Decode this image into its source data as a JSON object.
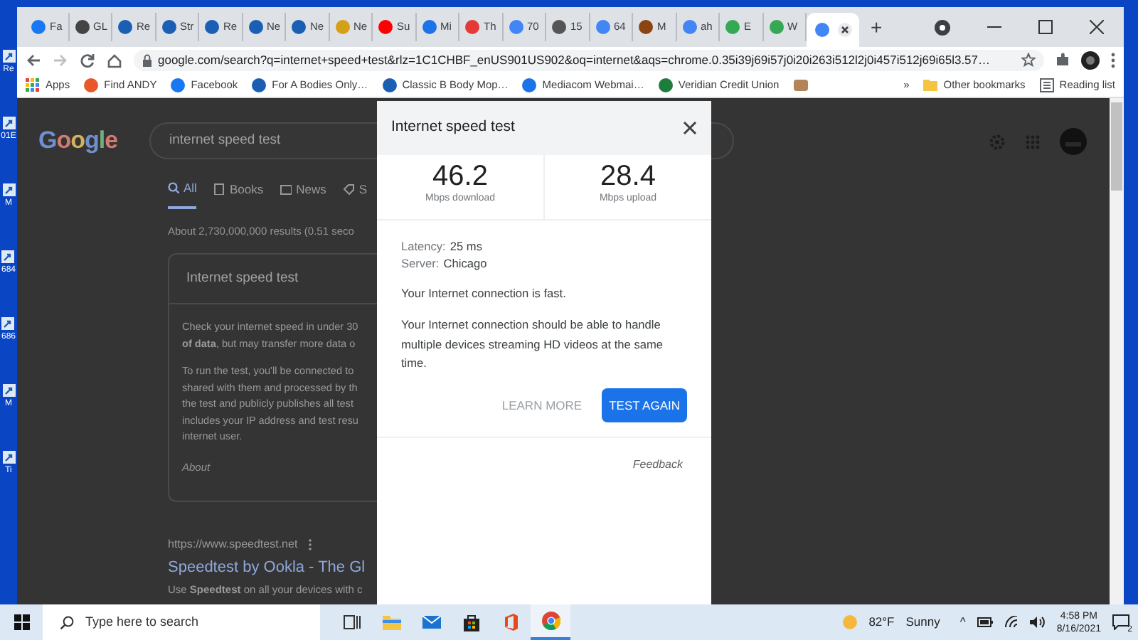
{
  "desktop_icons": [
    {
      "label": "Re"
    },
    {
      "label": "01E"
    },
    {
      "label": "M"
    },
    {
      "label": "684"
    },
    {
      "label": "686"
    },
    {
      "label": "M"
    },
    {
      "label": "Ti"
    }
  ],
  "browser": {
    "tabs": [
      {
        "label": "Fa",
        "color": "#1877f2",
        "selected": false
      },
      {
        "label": "GL",
        "color": "#444444",
        "selected": false
      },
      {
        "label": "Re",
        "color": "#1a5fb4",
        "selected": false
      },
      {
        "label": "Str",
        "color": "#1a5fb4",
        "selected": false
      },
      {
        "label": "Re",
        "color": "#1a5fb4",
        "selected": false
      },
      {
        "label": "Ne",
        "color": "#1a5fb4",
        "selected": false
      },
      {
        "label": "Ne",
        "color": "#1a5fb4",
        "selected": false
      },
      {
        "label": "Ne",
        "color": "#d4a017",
        "selected": false
      },
      {
        "label": "Su",
        "color": "#ff0000",
        "selected": false
      },
      {
        "label": "Mi",
        "color": "#1a73e8",
        "selected": false
      },
      {
        "label": "Th",
        "color": "#e53935",
        "selected": false
      },
      {
        "label": "70",
        "color": "#4285f4",
        "selected": false
      },
      {
        "label": "15",
        "color": "#555555",
        "selected": false
      },
      {
        "label": "64",
        "color": "#4285f4",
        "selected": false
      },
      {
        "label": "M",
        "color": "#8b4513",
        "selected": false
      },
      {
        "label": "ah",
        "color": "#4285f4",
        "selected": false
      },
      {
        "label": "E",
        "color": "#34a853",
        "selected": false
      },
      {
        "label": "W",
        "color": "#34a853",
        "selected": false
      },
      {
        "color": "#4285f4",
        "selected": true
      }
    ],
    "new_tab": "+",
    "address": "google.com/search?q=internet+speed+test&rlz=1C1CHBF_enUS901US902&oq=internet&aqs=chrome.0.35i39j69i57j0i20i263i512l2j0i457i512j69i65l3.57…",
    "bookmarks": [
      {
        "kind": "apps",
        "label": "Apps"
      },
      {
        "kind": "link",
        "label": "Find ANDY",
        "color": "#e8562a"
      },
      {
        "kind": "link",
        "label": "Facebook",
        "color": "#1877f2"
      },
      {
        "kind": "link",
        "label": "For A Bodies Only…",
        "color": "#1a5fb4"
      },
      {
        "kind": "link",
        "label": "Classic B Body Mop…",
        "color": "#1a5fb4"
      },
      {
        "kind": "link",
        "label": "Mediacom Webmai…",
        "color": "#1a73e8"
      },
      {
        "kind": "link",
        "label": "Veridian Credit Union",
        "color": "#1e7d3a"
      },
      {
        "kind": "icon",
        "color": "#b5835a"
      }
    ],
    "overflow": "»",
    "other_bookmarks": "Other bookmarks",
    "reading_list": "Reading list"
  },
  "google": {
    "logo": "Google",
    "search": "internet speed test",
    "tabs": [
      {
        "label": "All",
        "selected": true
      },
      {
        "label": "Books",
        "selected": false
      },
      {
        "label": "News",
        "selected": false
      },
      {
        "label": "S",
        "selected": false
      }
    ],
    "result_stats": "About 2,730,000,000 results (0.51 seco",
    "card_title": "Internet speed test",
    "card_para_1": [
      "Check your internet speed in under 30",
      "**of data**, but may transfer more data o"
    ],
    "card_para_2": [
      "To run the test, you'll be connected to",
      "shared with them and processed by th",
      "the test and publicly publishes all test",
      "includes your IP address and test resu",
      "internet user."
    ],
    "card_about": "About",
    "result_url": "https://www.speedtest.net",
    "result_title": "Speedtest by Ookla - The Gl",
    "result_snippet": "Use **Speedtest** on all your devices with c"
  },
  "dialog": {
    "title": "Internet speed test",
    "metrics": [
      {
        "value": "46.2",
        "unit": "Mbps download"
      },
      {
        "value": "28.4",
        "unit": "Mbps upload"
      }
    ],
    "details": [
      {
        "label": "Latency:",
        "value": "25 ms"
      },
      {
        "label": "Server:",
        "value": "Chicago"
      }
    ],
    "verdict": "Your Internet connection is fast.",
    "description": "Your Internet connection should be able to handle multiple devices streaming HD videos at the same time.",
    "learn_more": "LEARN MORE",
    "test_again": "TEST AGAIN",
    "feedback": "Feedback"
  },
  "taskbar": {
    "search_placeholder": "Type here to search",
    "apps": [
      {
        "kind": "taskview",
        "selected": false
      },
      {
        "kind": "explorer",
        "selected": false
      },
      {
        "kind": "mail",
        "selected": false
      },
      {
        "kind": "store",
        "selected": false
      },
      {
        "kind": "office",
        "selected": false
      },
      {
        "kind": "chrome",
        "selected": true
      }
    ],
    "temperature": "82°F",
    "weather": "Sunny",
    "tray_arrow": "^",
    "time": "4:58 PM",
    "date": "8/16/2021",
    "notifications": "2"
  }
}
